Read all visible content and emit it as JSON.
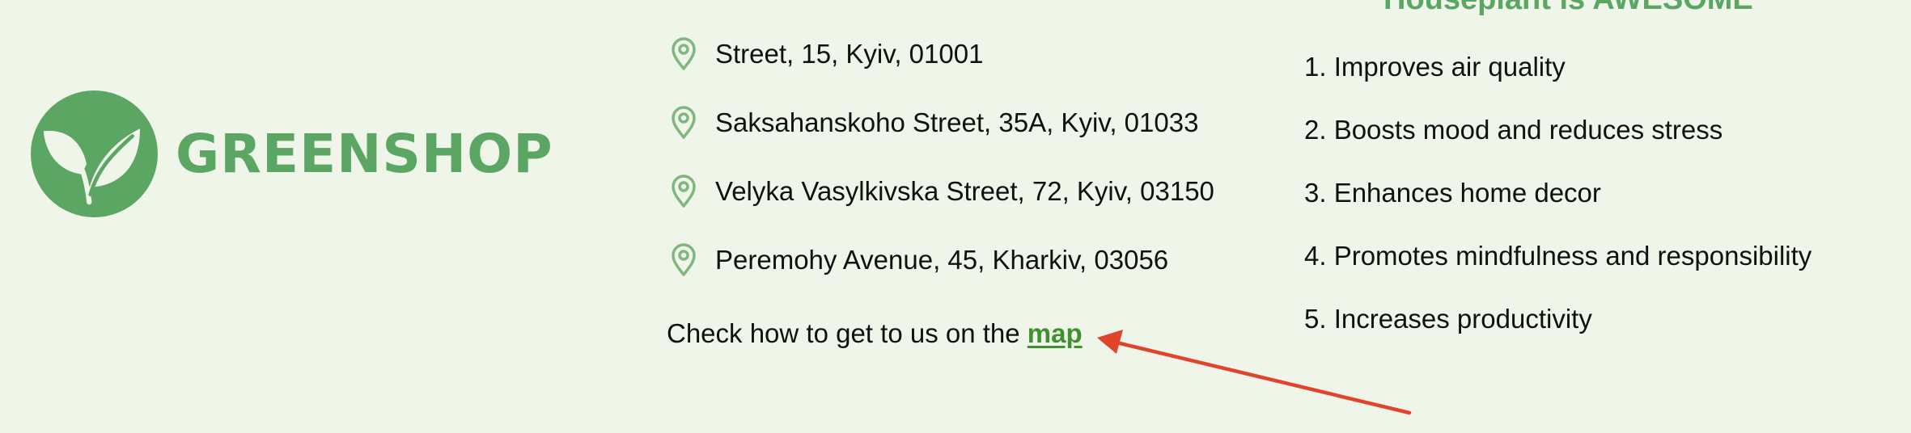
{
  "logo": {
    "brand": "GREENSHOP",
    "icon": "leaf-sprout-icon",
    "color": "#5ba662"
  },
  "addresses": [
    {
      "icon": "location-pin-icon",
      "text": "Street, 15, Kyiv, 01001"
    },
    {
      "icon": "location-pin-icon",
      "text": "Saksahanskoho Street, 35A, Kyiv, 01033"
    },
    {
      "icon": "location-pin-icon",
      "text": "Velyka Vasylkivska Street, 72, Kyiv, 03150"
    },
    {
      "icon": "location-pin-icon",
      "text": "Peremohy Avenue, 45, Kharkiv, 03056"
    }
  ],
  "map_line": {
    "prefix": "Check how to get to us on the ",
    "link_label": "map",
    "link_color": "#3f9130"
  },
  "benefits": {
    "title": "Houseplant is AWESOME",
    "items": [
      "1. Improves air quality",
      "2. Boosts mood and reduces stress",
      "3. Enhances home decor",
      "4. Promotes mindfulness and responsibility",
      "5. Increases productivity"
    ]
  },
  "annotation": {
    "icon": "red-arrow-icon",
    "color": "#e0442a"
  }
}
